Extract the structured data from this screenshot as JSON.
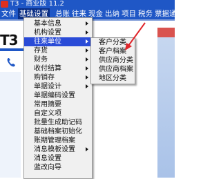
{
  "window": {
    "title": "T3 - 商业版 11.2"
  },
  "menubar": {
    "items": [
      "文件",
      "基础设置",
      "总账",
      "往来",
      "现金",
      "出纳",
      "项目",
      "税务",
      "票据通"
    ]
  },
  "logo": "T3",
  "main_menu": {
    "items": [
      {
        "label": "基本信息",
        "arrow": true
      },
      {
        "label": "机构设置",
        "arrow": true
      },
      {
        "label": "往来单位",
        "arrow": true,
        "highlighted": true
      },
      {
        "label": "存货",
        "arrow": true
      },
      {
        "label": "财务",
        "arrow": true
      },
      {
        "label": "收付结算",
        "arrow": true
      },
      {
        "label": "购销存",
        "arrow": true
      },
      {
        "label": "单据设计",
        "arrow": true
      },
      {
        "label": "单据编码设置",
        "arrow": false
      },
      {
        "label": "常用摘要",
        "arrow": false
      },
      {
        "label": "自定义项",
        "arrow": false
      },
      {
        "label": "批量生成助记码",
        "arrow": false
      },
      {
        "label": "基础档案初始化",
        "arrow": false
      },
      {
        "label": "账期管理档案",
        "arrow": false
      },
      {
        "label": "消息模板设置",
        "arrow": true
      },
      {
        "label": "消息设置",
        "arrow": false
      },
      {
        "label": "蓝改向导",
        "arrow": false
      }
    ]
  },
  "submenu": {
    "items": [
      {
        "label": "客户分类"
      },
      {
        "label": "客户档案"
      },
      {
        "label": "供应商分类"
      },
      {
        "label": "供应商档案"
      },
      {
        "label": "地区分类"
      }
    ]
  },
  "colors": {
    "menubar": "#1f57c6",
    "highlight": "#2a4bd7",
    "annotation_arrow": "#e0262b"
  }
}
